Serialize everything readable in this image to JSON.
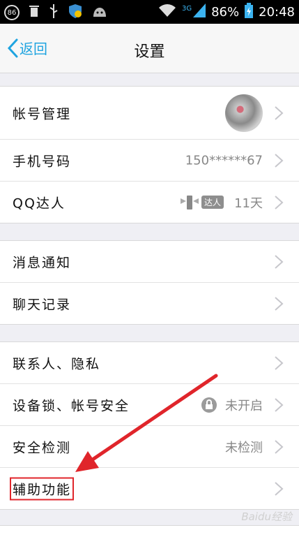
{
  "statusbar": {
    "notification_count": "86",
    "network": "3G",
    "battery": "86%",
    "time": "20:48"
  },
  "navbar": {
    "back_label": "返回",
    "title": "设置"
  },
  "groups": {
    "account": {
      "account_management": "帐号管理",
      "phone_label": "手机号码",
      "phone_value": "150******67",
      "qq_daren_label": "QQ达人",
      "qq_daren_badge": "达人",
      "qq_daren_value": "11天"
    },
    "messages": {
      "notifications": "消息通知",
      "chat_history": "聊天记录"
    },
    "privacy": {
      "contacts_privacy": "联系人、隐私",
      "device_lock_label": "设备锁、帐号安全",
      "device_lock_value": "未开启",
      "security_check_label": "安全检测",
      "security_check_value": "未检测",
      "accessibility": "辅助功能"
    }
  },
  "watermark": "Baidu经验",
  "colors": {
    "accent": "#1fa4e0",
    "highlight": "#e0252b",
    "arrow": "#e0252b"
  }
}
